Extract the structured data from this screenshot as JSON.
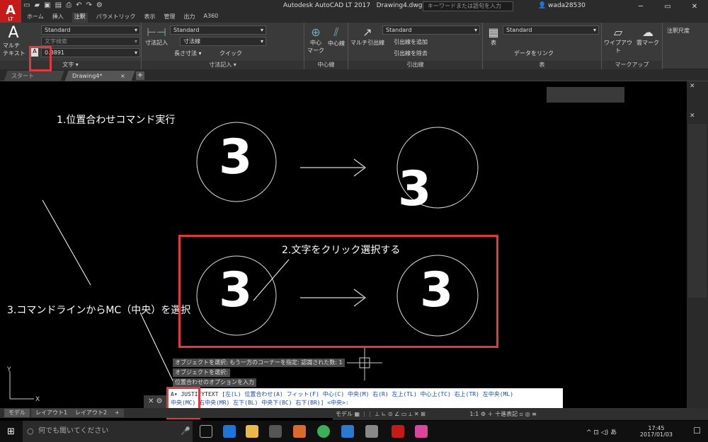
{
  "titlebar": {
    "app_title": "Autodesk AutoCAD LT 2017",
    "doc_title": "Drawing4.dwg",
    "search_placeholder": "キーワードまたは語句を入力",
    "username": "wada28530",
    "logo_text": "A",
    "logo_sub": "LT"
  },
  "ribbon_tabs": [
    "ホーム",
    "挿入",
    "注釈",
    "パラメトリック",
    "表示",
    "管理",
    "出力",
    "A360"
  ],
  "ribbon": {
    "text_panel": {
      "label": "文字 ▾",
      "big_button": "マルチ\nテキスト",
      "style": "Standard",
      "search": "文字検索",
      "height": "0.8891"
    },
    "dim_panel": {
      "label": "寸法記入 ▾",
      "big_button": "寸法記入",
      "style": "Standard",
      "layer": "寸法線",
      "length": "長さ寸法",
      "quick": "クイック"
    },
    "center_panel": {
      "label": "中心線",
      "center_mark": "中心\nマーク",
      "center_line": "中心線"
    },
    "leader_panel": {
      "label": "引出線",
      "big_button": "マルチ引出線",
      "style": "Standard",
      "add": "引出線を追加",
      "remove": "引出線を除去"
    },
    "table_panel": {
      "label": "表",
      "big_button": "表",
      "style": "Standard",
      "link": "データをリンク"
    },
    "markup_panel": {
      "label": "マークアップ",
      "wipeout": "ワイプアウト",
      "cloud": "雲マーク"
    },
    "scale_panel": {
      "label": "注釈尺度"
    }
  },
  "doc_tabs": {
    "start": "スタート",
    "drawing": "Drawing4*",
    "close": "×",
    "plus": "+"
  },
  "canvas": {
    "digit": "3"
  },
  "annotations": {
    "step1": "1.位置合わせコマンド実行",
    "step2": "2.文字をクリック選択する",
    "step3": "3.コマンドラインからMC（中央）を選択"
  },
  "command_history": [
    "オブジェクトを選択: もう一方のコーナーを指定: 認識された数: 1",
    "オブジェクトを選択:",
    "位置合わせのオプションを入力"
  ],
  "command_line": {
    "prefix": "A▾ JUSTIFYTEXT [",
    "options1": "左(L) 位置合わせ(A) フィット(F) 中心(C) 中央(M) 右(R) 左上(TL) 中心上(TC) 右上(TR) 左中央(ML)",
    "options2": "中央(MC) 右中央(MR) 左下(BL) 中央下(BC) 右下(BR)] <中央>:"
  },
  "layout_tabs": [
    "モデル",
    "レイアウト1",
    "レイアウト2",
    "+"
  ],
  "statusbar": {
    "model": "モデル",
    "scale": "1:1",
    "unit": "十進表記"
  },
  "taskbar": {
    "search": "何でも聞いてください",
    "time": "17:45",
    "date": "2017/01/03",
    "ime": "あ"
  },
  "colors": {
    "annotation_red": "#e2383f",
    "canvas_bg": "#000000",
    "autocad_red": "#c41a1a"
  }
}
